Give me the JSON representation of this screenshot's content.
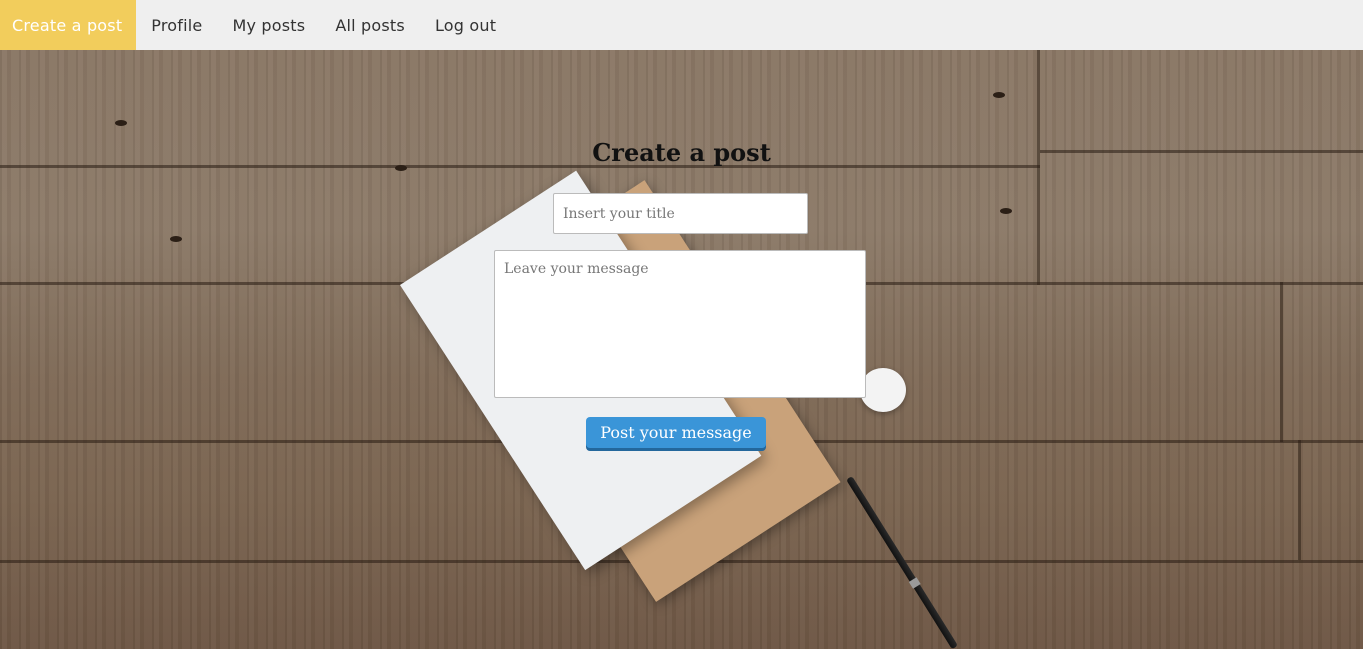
{
  "nav": {
    "items": [
      {
        "label": "Create a post",
        "active": true
      },
      {
        "label": "Profile",
        "active": false
      },
      {
        "label": "My posts",
        "active": false
      },
      {
        "label": "All posts",
        "active": false
      },
      {
        "label": "Log out",
        "active": false
      }
    ],
    "active_color": "#f2cd5c",
    "bar_color": "#efefef"
  },
  "form": {
    "heading": "Create a post",
    "title_placeholder": "Insert your title",
    "title_value": "",
    "message_placeholder": "Leave your message",
    "message_value": "",
    "submit_label": "Post your message",
    "submit_color": "#3a95d8"
  }
}
